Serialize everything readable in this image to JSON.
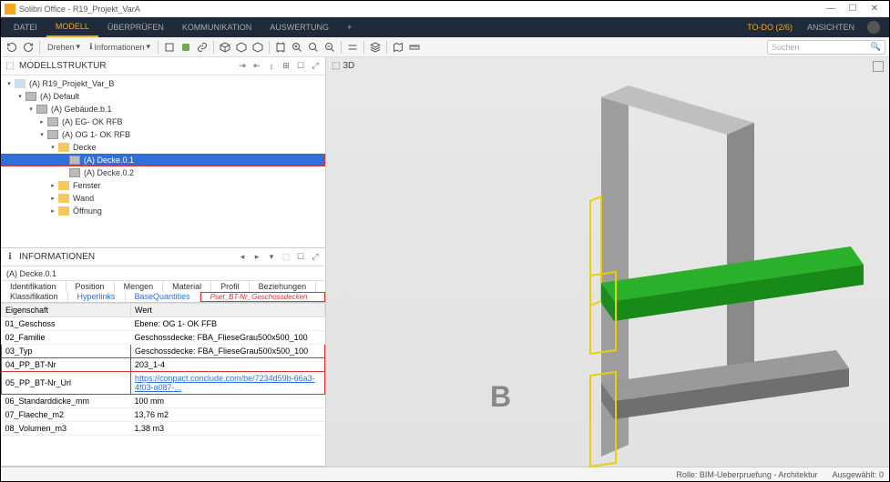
{
  "titlebar": {
    "title": "Solibri Office - R19_Projekt_VarA"
  },
  "menu": {
    "items": [
      "DATEI",
      "MODELL",
      "ÜBERPRÜFEN",
      "KOMMUNIKATION",
      "AUSWERTUNG"
    ],
    "active": 1,
    "plus": "+",
    "todo": "TO-DO (2/6)",
    "views": "ANSICHTEN"
  },
  "toolbar": {
    "rotate_label": "Drehen",
    "info_label": "Informationen",
    "search_placeholder": "Suchen"
  },
  "tree_panel": {
    "title": "MODELLSTRUKTUR",
    "rows": [
      {
        "indent": 0,
        "toggle": "▾",
        "icon": "model",
        "label": "(A) R19_Projekt_Var_B"
      },
      {
        "indent": 1,
        "toggle": "▾",
        "icon": "cube",
        "label": "(A) Default"
      },
      {
        "indent": 2,
        "toggle": "▾",
        "icon": "cube",
        "label": "(A) Gebäude.b.1"
      },
      {
        "indent": 3,
        "toggle": "▸",
        "icon": "cube",
        "label": "(A) EG- OK RFB"
      },
      {
        "indent": 3,
        "toggle": "▾",
        "icon": "cube",
        "label": "(A) OG 1- OK RFB"
      },
      {
        "indent": 4,
        "toggle": "▾",
        "icon": "folder",
        "label": "Decke"
      },
      {
        "indent": 5,
        "toggle": "",
        "icon": "cube",
        "label": "(A) Decke.0.1",
        "selected": true,
        "red": true
      },
      {
        "indent": 5,
        "toggle": "",
        "icon": "cube",
        "label": "(A) Decke.0.2"
      },
      {
        "indent": 4,
        "toggle": "▸",
        "icon": "folder",
        "label": "Fenster"
      },
      {
        "indent": 4,
        "toggle": "▸",
        "icon": "folder",
        "label": "Wand"
      },
      {
        "indent": 4,
        "toggle": "▸",
        "icon": "folder",
        "label": "Öffnung"
      }
    ]
  },
  "info_panel": {
    "title": "INFORMATIONEN",
    "sub": "(A) Decke.0.1",
    "tabs_row1": [
      "Identifikation",
      "Position",
      "Mengen",
      "Material",
      "Profil",
      "Beziehungen"
    ],
    "tabs_row2": [
      "Klassifikation",
      "Hyperlinks",
      "BaseQuantities"
    ],
    "banner": "Pset_BT-Nr_Geschossdecken",
    "columns": {
      "prop": "Eigenschaft",
      "val": "Wert"
    },
    "rows": [
      {
        "prop": "01_Geschoss",
        "val": "Ebene: OG 1- OK FFB"
      },
      {
        "prop": "02_Familie",
        "val": "Geschossdecke: FBA_FlieseGrau500x500_100"
      },
      {
        "prop": "03_Typ",
        "val": "Geschossdecke: FBA_FlieseGrau500x500_100",
        "red": true
      },
      {
        "prop": "04_PP_BT-Nr",
        "val": "203_1-4",
        "red": true
      },
      {
        "prop": "05_PP_BT-Nr_Url",
        "val": "https://conpact.conclude.com/be/7234d59b-66a3-4f03-a087-...",
        "red": true,
        "link": true
      },
      {
        "prop": "06_Standarddicke_mm",
        "val": "100 mm"
      },
      {
        "prop": "07_Flaeche_m2",
        "val": "13,76 m2"
      },
      {
        "prop": "08_Volumen_m3",
        "val": "1,38 m3"
      }
    ]
  },
  "viewport": {
    "label": "3D",
    "letter": "B"
  },
  "status": {
    "role": "Rolle: BIM-Ueberpruefung - Architektur",
    "sel": "Ausgewählt: 0"
  }
}
